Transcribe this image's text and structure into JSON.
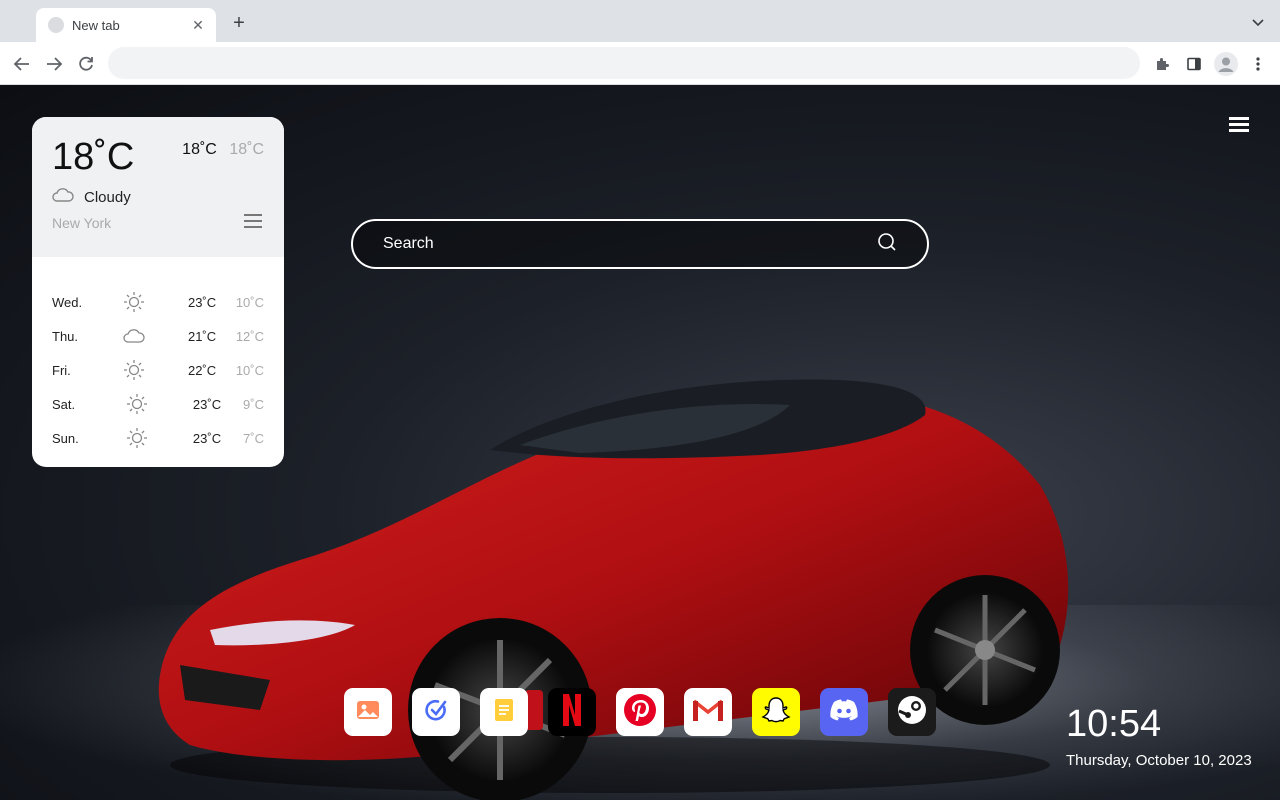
{
  "browser": {
    "tab_title": "New tab",
    "tab_close_icon": "close-icon",
    "new_tab_icon": "plus-icon",
    "address_value": ""
  },
  "weather": {
    "current_temp": "18˚C",
    "high": "18˚C",
    "low": "18˚C",
    "condition": "Cloudy",
    "condition_icon": "cloud-icon",
    "city": "New York",
    "forecast": [
      {
        "day": "Wed.",
        "icon": "sun-icon",
        "high": "23˚C",
        "low": "10˚C"
      },
      {
        "day": "Thu.",
        "icon": "cloud-icon",
        "high": "21˚C",
        "low": "12˚C"
      },
      {
        "day": "Fri.",
        "icon": "sun-icon",
        "high": "22˚C",
        "low": "10˚C"
      },
      {
        "day": "Sat.",
        "icon": "sun-icon",
        "high": "23˚C",
        "low": "9˚C"
      },
      {
        "day": "Sun.",
        "icon": "sun-icon",
        "high": "23˚C",
        "low": "7˚C"
      }
    ]
  },
  "search": {
    "placeholder": "Search"
  },
  "dock": [
    {
      "name": "photos",
      "icon": "image-icon",
      "color": "#ffffff"
    },
    {
      "name": "tasks",
      "icon": "check-icon",
      "color": "#ffffff"
    },
    {
      "name": "notes",
      "icon": "notes-icon",
      "color": "#ffffff"
    },
    {
      "name": "netflix",
      "icon": "netflix-icon",
      "color": "#000000"
    },
    {
      "name": "pinterest",
      "icon": "pinterest-icon",
      "color": "#ffffff"
    },
    {
      "name": "gmail",
      "icon": "gmail-icon",
      "color": "#ffffff"
    },
    {
      "name": "snapchat",
      "icon": "snapchat-icon",
      "color": "#fffc00"
    },
    {
      "name": "discord",
      "icon": "discord-icon",
      "color": "#5865f2"
    },
    {
      "name": "steam",
      "icon": "steam-icon",
      "color": "#1b1b1b"
    }
  ],
  "clock": {
    "time": "10:54",
    "date": "Thursday, October 10, 2023"
  }
}
